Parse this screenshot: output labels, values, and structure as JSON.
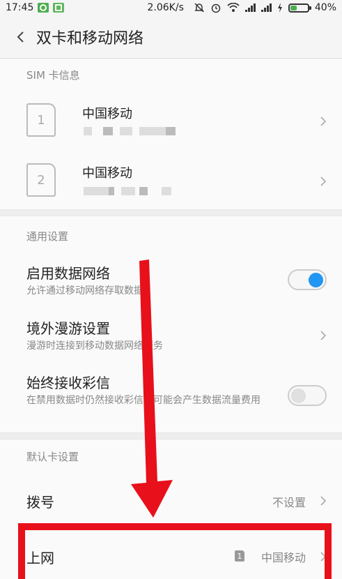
{
  "status_bar": {
    "time": "17:45",
    "speed": "2.06K/s",
    "battery_percent": "40%",
    "battery_level": 0.4,
    "icons": [
      "app-icon",
      "app-icon",
      "mute-bell-icon",
      "alarm-icon",
      "wifi-icon",
      "signal-icon",
      "signal-icon",
      "charging-icon",
      "battery-icon"
    ]
  },
  "header": {
    "title": "双卡和移动网络"
  },
  "sim_section": {
    "title": "SIM 卡信息",
    "cards": [
      {
        "slot": "1",
        "name": "中国移动"
      },
      {
        "slot": "2",
        "name": "中国移动"
      }
    ]
  },
  "general_section": {
    "title": "通用设置",
    "items": [
      {
        "title": "启用数据网络",
        "desc": "允许通过移动网络存取数据",
        "toggle": true
      },
      {
        "title": "境外漫游设置",
        "desc": "漫游时连接到移动数据网络服务"
      },
      {
        "title": "始终接收彩信",
        "desc": "在禁用数据时仍然接收彩信，可能会产生数据流量费用",
        "toggle": false
      }
    ]
  },
  "default_section": {
    "title": "默认卡设置",
    "items": [
      {
        "title": "拨号",
        "value": "不设置"
      },
      {
        "title": "上网",
        "value": "中国移动",
        "sim_badge": "1"
      }
    ]
  },
  "colors": {
    "accent": "#2196f3",
    "annotation_red": "#e8101a"
  }
}
